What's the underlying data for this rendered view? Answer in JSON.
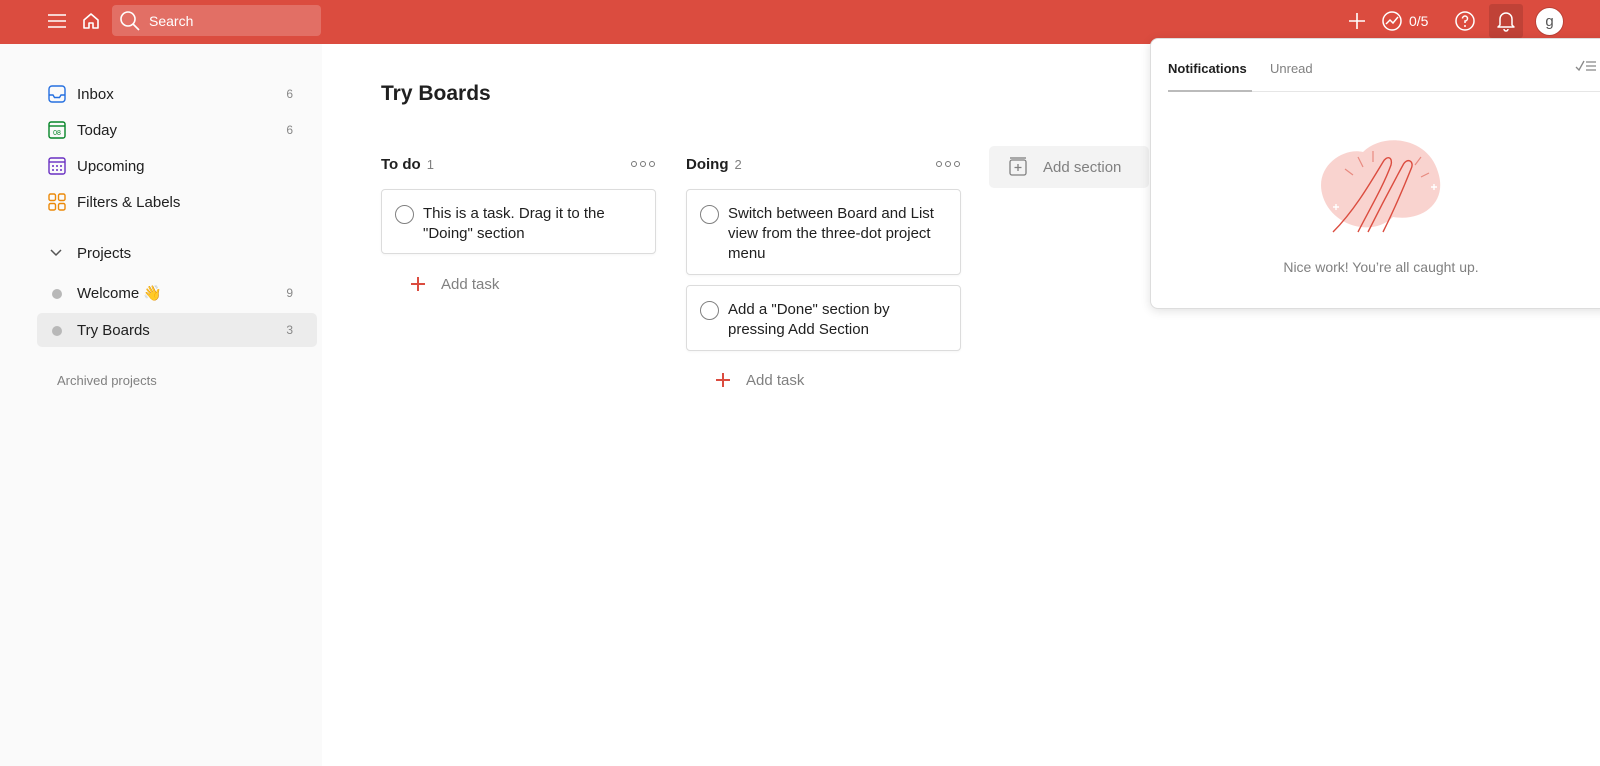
{
  "topbar": {
    "search_placeholder": "Search",
    "karma": "0/5",
    "avatar_initial": "g",
    "accent": "#db4c3f"
  },
  "sidebar": {
    "items": [
      {
        "label": "Inbox",
        "count": "6",
        "icon": "inbox-icon",
        "color": "#246fe0"
      },
      {
        "label": "Today",
        "count": "6",
        "icon": "calendar-today-icon",
        "color": "#058527",
        "day": "08"
      },
      {
        "label": "Upcoming",
        "count": "",
        "icon": "calendar-upcoming-icon",
        "color": "#692fc2"
      },
      {
        "label": "Filters & Labels",
        "count": "",
        "icon": "filters-icon",
        "color": "#eb8909"
      }
    ],
    "projects_label": "Projects",
    "projects": [
      {
        "label": "Welcome 👋",
        "count": "9"
      },
      {
        "label": "Try Boards",
        "count": "3"
      }
    ],
    "archived_label": "Archived projects"
  },
  "main": {
    "title": "Try Boards",
    "columns": [
      {
        "name": "To do",
        "count": "1",
        "tasks": [
          "This is a task. Drag it to the \"Doing\" section"
        ],
        "add_task": "Add task"
      },
      {
        "name": "Doing",
        "count": "2",
        "tasks": [
          "Switch between Board and List view from the three-dot project menu",
          "Add a \"Done\" section by pressing Add Section"
        ],
        "add_task": "Add task"
      }
    ],
    "add_section": "Add section"
  },
  "notifications": {
    "tabs": [
      "Notifications",
      "Unread"
    ],
    "active_tab": "Notifications",
    "empty_message": "Nice work! You’re all caught up."
  }
}
